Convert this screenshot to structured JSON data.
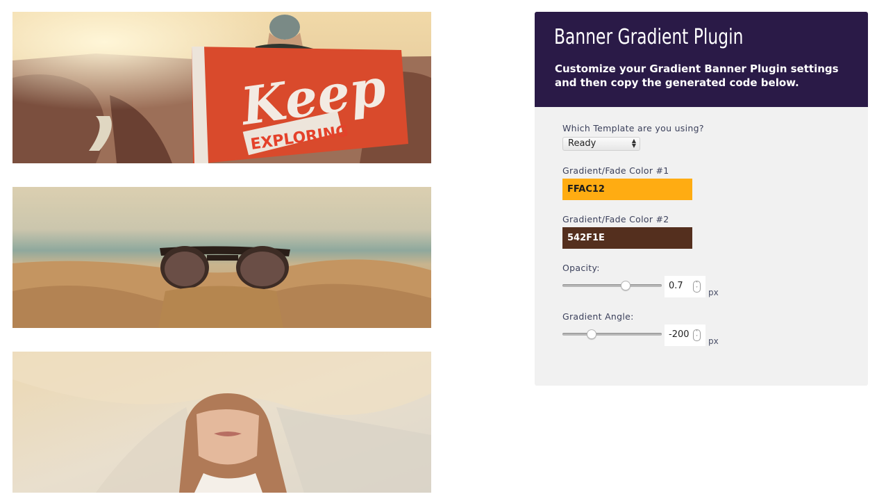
{
  "banners": [
    {
      "name": "keep-exploring-banner",
      "flag_word1": "Keep",
      "flag_word2": "EXPLORING"
    },
    {
      "name": "sunglasses-beach-banner"
    },
    {
      "name": "woman-under-sheet-banner"
    }
  ],
  "panel": {
    "title": "Banner Gradient Plugin",
    "description": "Customize your Gradient Banner Plugin settings and then copy the generated code below.",
    "template": {
      "label": "Which Template are you using?",
      "selected": "Ready"
    },
    "color1": {
      "label": "Gradient/Fade Color #1",
      "value": "FFAC12",
      "swatch": "#ffac12",
      "text_color": "#1c1c1c"
    },
    "color2": {
      "label": "Gradient/Fade Color #2",
      "value": "542F1E",
      "swatch": "#542f1e",
      "text_color": "#ffffff"
    },
    "opacity": {
      "label": "Opacity:",
      "value": "0.7",
      "unit": "px",
      "slider_fraction": 0.64
    },
    "angle": {
      "label": "Gradient Angle:",
      "value": "-200",
      "unit": "px",
      "slider_fraction": 0.27
    }
  },
  "colors": {
    "header_bg": "#2a1a47",
    "panel_bg": "#f1f1f1"
  }
}
